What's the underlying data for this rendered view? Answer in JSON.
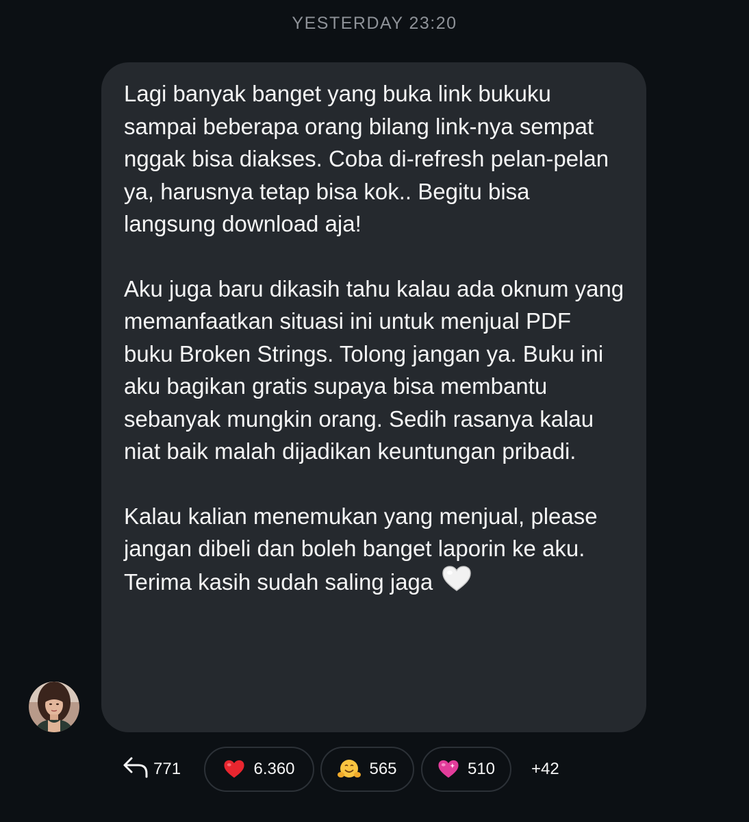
{
  "timestamp": "YESTERDAY 23:20",
  "message": {
    "paragraphs": [
      "Lagi banyak banget yang buka link bukuku sampai beberapa orang bilang link-nya sempat nggak bisa diakses. Coba di-refresh pelan-pelan ya, harusnya tetap bisa kok.. Begitu bisa langsung download aja!",
      "Aku juga baru dikasih tahu kalau ada oknum yang memanfaatkan situasi ini untuk menjual PDF buku Broken Strings. Tolong jangan ya. Buku ini aku bagikan gratis supaya bisa membantu sebanyak mungkin orang. Sedih rasanya kalau niat baik malah dijadikan keuntungan pribadi.",
      "Kalau kalian menemukan yang menjual, please jangan dibeli dan boleh banget laporin ke aku. Terima kasih sudah saling jaga"
    ],
    "trailing_emoji": "white-heart-icon"
  },
  "sender": {
    "avatar_icon": "profile-photo"
  },
  "reactions": {
    "reply_count": "771",
    "items": [
      {
        "emoji": "red-heart-icon",
        "count": "6.360"
      },
      {
        "emoji": "hugging-face-icon",
        "count": "565"
      },
      {
        "emoji": "sparkling-heart-icon",
        "count": "510"
      }
    ],
    "more": "+42"
  },
  "colors": {
    "background": "#0c1014",
    "bubble": "#25292e",
    "text": "#f5f5f5",
    "muted": "#8e9298",
    "pill_border": "#2c3137"
  }
}
